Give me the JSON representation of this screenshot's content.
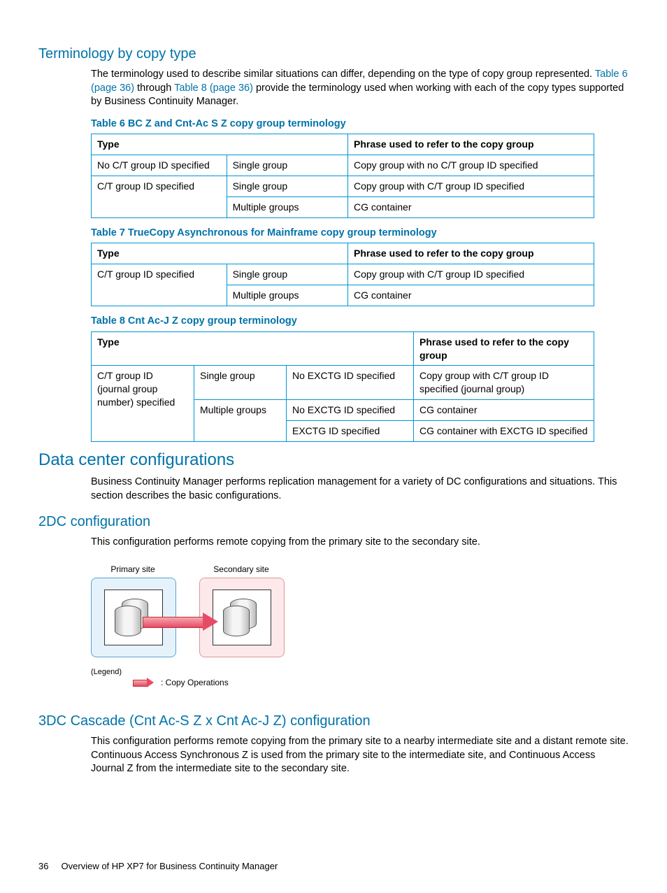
{
  "section1": {
    "title": "Terminology by copy type",
    "intro_a": "The terminology used to describe similar situations can differ, depending on the type of copy group represented. ",
    "link1": "Table 6 (page 36)",
    "intro_b": " through ",
    "link2": "Table 8 (page 36)",
    "intro_c": " provide the terminology used when working with each of the copy types supported by Business Continuity Manager."
  },
  "table6": {
    "caption": "Table 6 BC Z and Cnt-Ac S Z copy group terminology",
    "h1": "Type",
    "h2": "Phrase used to refer to the copy group",
    "r1c1": "No C/T group ID specified",
    "r1c2": "Single group",
    "r1c3": "Copy group with no C/T group ID specified",
    "r2c1": "C/T group ID specified",
    "r2c2": "Single group",
    "r2c3": "Copy group with C/T group ID specified",
    "r3c2": "Multiple groups",
    "r3c3": "CG container"
  },
  "table7": {
    "caption": "Table 7 TrueCopy Asynchronous for Mainframe copy group terminology",
    "h1": "Type",
    "h2": "Phrase used to refer to the copy group",
    "r1c1": "C/T group ID specified",
    "r1c2": "Single group",
    "r1c3": "Copy group with C/T group ID specified",
    "r2c2": "Multiple groups",
    "r2c3": "CG container"
  },
  "table8": {
    "caption": "Table 8 Cnt Ac-J Z copy group terminology",
    "h1": "Type",
    "h2": "Phrase used to refer to the copy group",
    "r1c1": "C/T group ID (journal group number) specified",
    "r1c2": "Single group",
    "r1c3": "No EXCTG ID specified",
    "r1c4": "Copy group with C/T group ID specified (journal group)",
    "r2c2": "Multiple groups",
    "r2c3": "No EXCTG ID specified",
    "r2c4": "CG container",
    "r3c3": "EXCTG ID specified",
    "r3c4": "CG container with EXCTG ID specified"
  },
  "section2": {
    "title": "Data center configurations",
    "body": "Business Continuity Manager performs replication management for a variety of DC configurations and situations. This section describes the basic configurations."
  },
  "section3": {
    "title": "2DC configuration",
    "body": "This configuration performs remote copying from the primary site to the secondary site."
  },
  "diagram": {
    "primary": "Primary site",
    "secondary": "Secondary site",
    "legend": "(Legend)",
    "copyops": ": Copy Operations"
  },
  "section4": {
    "title": "3DC Cascade (Cnt Ac-S Z x Cnt Ac-J Z) configuration",
    "body": "This configuration performs remote copying from the primary site to a nearby intermediate site and a distant remote site. Continuous Access Synchronous Z is used from the primary site to the intermediate site, and Continuous Access Journal Z from the intermediate site to the secondary site."
  },
  "footer": {
    "pagenum": "36",
    "title": "Overview of HP XP7 for Business Continuity Manager"
  }
}
